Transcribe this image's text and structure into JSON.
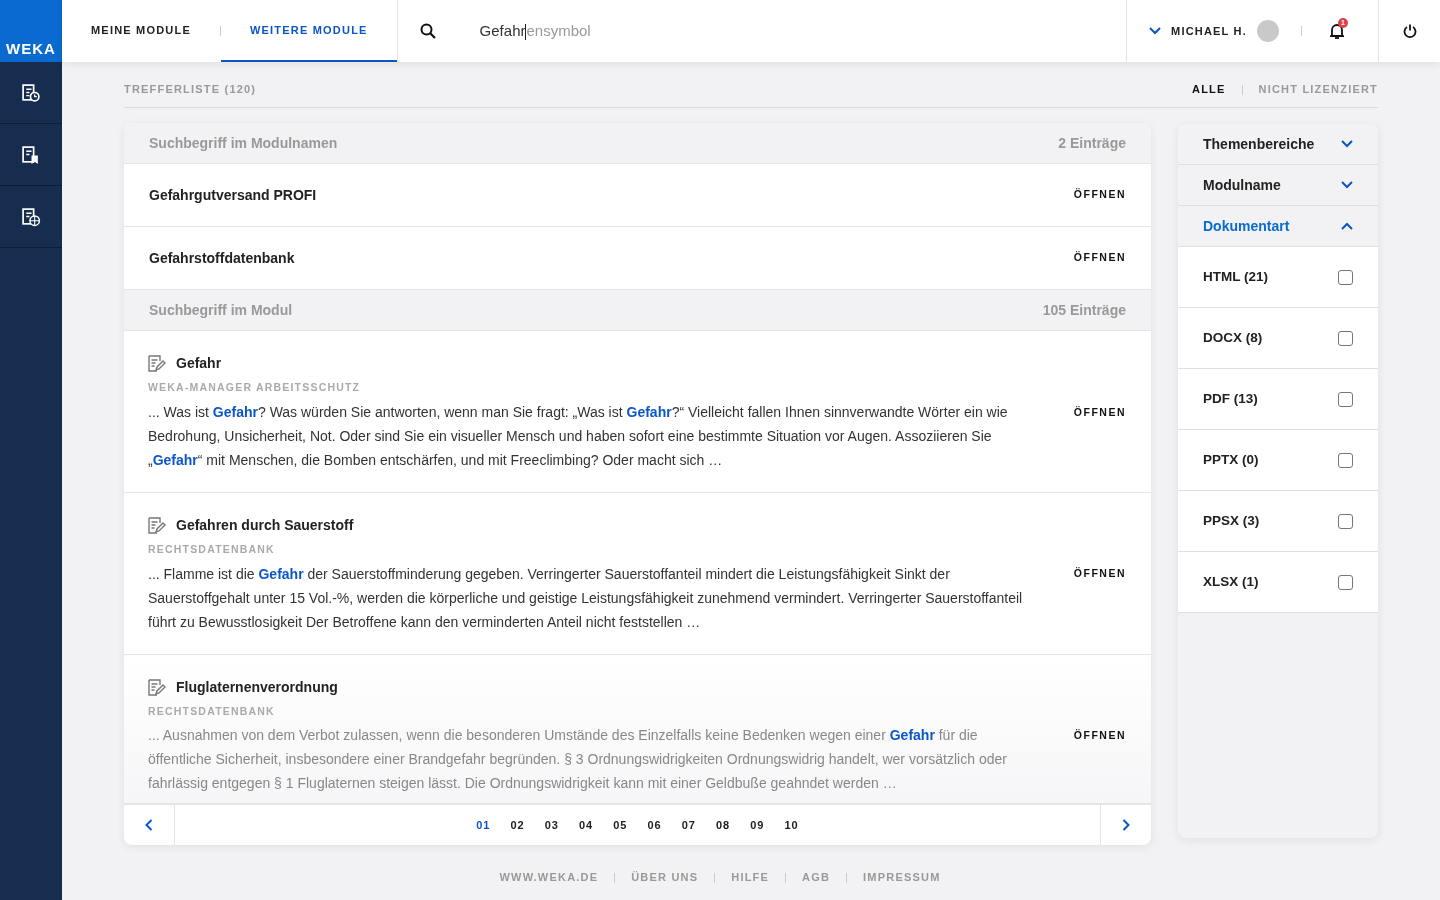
{
  "logo": {
    "text": "WEKA"
  },
  "side_nav": [
    {
      "kind": "clock",
      "selected": false
    },
    {
      "kind": "bookmark",
      "selected": false
    },
    {
      "kind": "globe",
      "selected": false
    }
  ],
  "tabs": [
    {
      "label": "MEINE MODULE",
      "selected": false
    },
    {
      "label": "WEITERE MODULE",
      "selected": true
    }
  ],
  "search": {
    "value": "Gefahr",
    "suggestion": "ensymbol"
  },
  "user": {
    "name": "MICHAEL H.",
    "notifications": "1"
  },
  "results_header": {
    "title": "TREFFERLISTE (120)",
    "filters": [
      {
        "label": "ALLE",
        "selected": true
      },
      {
        "label": "NICHT LIZENZIERT",
        "selected": false
      }
    ]
  },
  "groups": [
    {
      "title": "Suchbegriff im Modulnamen",
      "count": "2 Einträge",
      "items": [
        {
          "kind": "module",
          "title": "Gefahrgutversand PROFI",
          "action": "ÖFFNEN"
        },
        {
          "kind": "module",
          "title": "Gefahrstoffdatenbank",
          "action": "ÖFFNEN"
        }
      ]
    },
    {
      "title": "Suchbegriff im Modul",
      "count": "105 Einträge",
      "items": [
        {
          "kind": "document",
          "title": "Gefahr",
          "source": "WEKA-MANAGER ARBEITSSCHUTZ",
          "snippet": "... Was ist **Gefahr**? Was würden Sie antworten, wenn man Sie fragt: „Was ist **Gefahr**?“ Vielleicht fallen Ihnen sinnverwandte Wörter ein wie Bedrohung, Unsicherheit, Not. Oder sind Sie ein visueller Mensch und haben sofort eine bestimmte Situation vor Augen. Assoziieren Sie „**Gefahr**“ mit Menschen, die Bomben entschärfen, und mit Freeclimbing? Oder macht sich …",
          "action": "ÖFFNEN",
          "faded": false
        },
        {
          "kind": "document",
          "title": "Gefahren durch Sauerstoff",
          "source": "RECHTSDATENBANK",
          "snippet": "... Flamme ist die **Gefahr** der Sauerstoffminderung gegeben. Verringerter Sauerstoffanteil mindert die Leistungsfähigkeit Sinkt der Sauerstoffgehalt unter 15 Vol.-%, werden die körperliche und geistige Leistungsfähigkeit zunehmend vermindert. Verringerter Sauerstoffanteil führt zu Bewusstlosigkeit Der Betroffene kann den verminderten Anteil nicht feststellen …",
          "action": "ÖFFNEN",
          "faded": false
        },
        {
          "kind": "document",
          "title": "Fluglaternenverordnung",
          "source": "RECHTSDATENBANK",
          "snippet": "... Ausnahmen von dem Verbot zulassen, wenn die besonderen Umstände des Einzelfalls keine Bedenken wegen einer **Gefahr** für die öffentliche Sicherheit, insbesondere einer Brandgefahr begründen. § 3 Ordnungswidrigkeiten Ordnungswidrig handelt, wer vorsätzlich oder fahrlässig entgegen § 1 Fluglaternen steigen lässt. Die Ordnungswidrigkeit kann mit einer Geldbuße geahndet werden …",
          "action": "ÖFFNEN",
          "faded": true
        }
      ]
    }
  ],
  "pagination": {
    "pages": [
      {
        "label": "01",
        "selected": true
      },
      {
        "label": "02",
        "selected": false
      },
      {
        "label": "03",
        "selected": false
      },
      {
        "label": "04",
        "selected": false
      },
      {
        "label": "05",
        "selected": false
      },
      {
        "label": "06",
        "selected": false
      },
      {
        "label": "07",
        "selected": false
      },
      {
        "label": "08",
        "selected": false
      },
      {
        "label": "09",
        "selected": false
      },
      {
        "label": "10",
        "selected": false
      }
    ]
  },
  "filter_panel": [
    {
      "title": "Themenbereiche",
      "expanded": false
    },
    {
      "title": "Modulname",
      "expanded": false
    },
    {
      "title": "Dokumentart",
      "expanded": true,
      "options": [
        {
          "label": "HTML (21)",
          "checked": false
        },
        {
          "label": "DOCX (8)",
          "checked": false
        },
        {
          "label": "PDF (13)",
          "checked": false
        },
        {
          "label": "PPTX (0)",
          "checked": false
        },
        {
          "label": "PPSX (3)",
          "checked": false
        },
        {
          "label": "XLSX (1)",
          "checked": false
        }
      ]
    }
  ],
  "footer": [
    "WWW.WEKA.DE",
    "ÜBER UNS",
    "HILFE",
    "AGB",
    "IMPRESSUM"
  ]
}
